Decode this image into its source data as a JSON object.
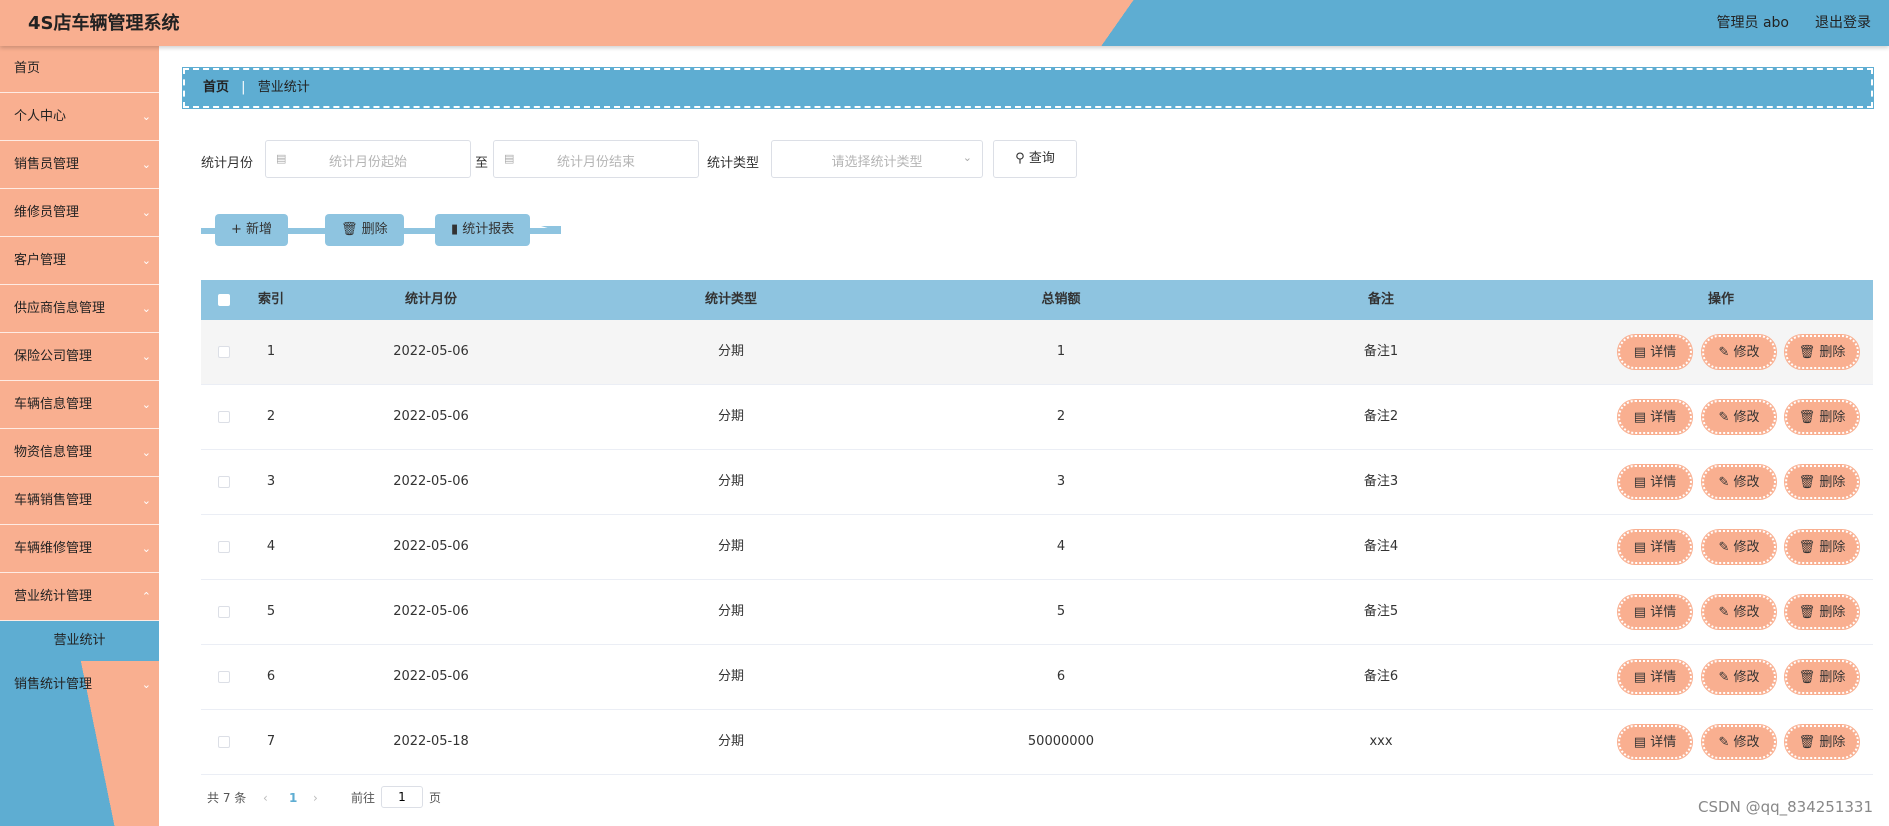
{
  "header": {
    "title": "4S店车辆管理系统",
    "user": "管理员 abo",
    "logout": "退出登录"
  },
  "sidebar": {
    "items": [
      {
        "label": "首页"
      },
      {
        "label": "个人中心"
      },
      {
        "label": "销售员管理"
      },
      {
        "label": "维修员管理"
      },
      {
        "label": "客户管理"
      },
      {
        "label": "供应商信息管理"
      },
      {
        "label": "保险公司管理"
      },
      {
        "label": "车辆信息管理"
      },
      {
        "label": "物资信息管理"
      },
      {
        "label": "车辆销售管理"
      },
      {
        "label": "车辆维修管理"
      },
      {
        "label": "营业统计管理"
      },
      {
        "label": "销售统计管理"
      }
    ],
    "active_sub": "营业统计",
    "chevron": "chevron-down-icon"
  },
  "breadcrumb": {
    "home": "首页",
    "current": "营业统计"
  },
  "search": {
    "month_label": "统计月份",
    "start_placeholder": "统计月份起始",
    "to": "至",
    "end_placeholder": "统计月份结束",
    "type_label": "统计类型",
    "type_placeholder": "请选择统计类型",
    "query": "查询"
  },
  "actions": {
    "add": "新增",
    "delete": "删除",
    "report": "统计报表"
  },
  "table": {
    "headers": [
      "索引",
      "统计月份",
      "统计类型",
      "总销额",
      "备注",
      "操作"
    ],
    "rows": [
      {
        "idx": "1",
        "month": "2022-05-06",
        "type": "分期",
        "total": "1",
        "note": "备注1"
      },
      {
        "idx": "2",
        "month": "2022-05-06",
        "type": "分期",
        "total": "2",
        "note": "备注2"
      },
      {
        "idx": "3",
        "month": "2022-05-06",
        "type": "分期",
        "total": "3",
        "note": "备注3"
      },
      {
        "idx": "4",
        "month": "2022-05-06",
        "type": "分期",
        "total": "4",
        "note": "备注4"
      },
      {
        "idx": "5",
        "month": "2022-05-06",
        "type": "分期",
        "total": "5",
        "note": "备注5"
      },
      {
        "idx": "6",
        "month": "2022-05-06",
        "type": "分期",
        "total": "6",
        "note": "备注6"
      },
      {
        "idx": "7",
        "month": "2022-05-18",
        "type": "分期",
        "total": "50000000",
        "note": "xxx"
      }
    ],
    "ops": {
      "detail": "详情",
      "edit": "修改",
      "delete": "删除"
    }
  },
  "pagination": {
    "total": "共 7 条",
    "current": "1",
    "goto": "前往",
    "page_value": "1",
    "page_suffix": "页"
  },
  "watermark": "CSDN @qq_834251331",
  "colors": {
    "salmon": "#f9af90",
    "blue": "#5eadd2",
    "light_blue": "#8ec4e0"
  }
}
